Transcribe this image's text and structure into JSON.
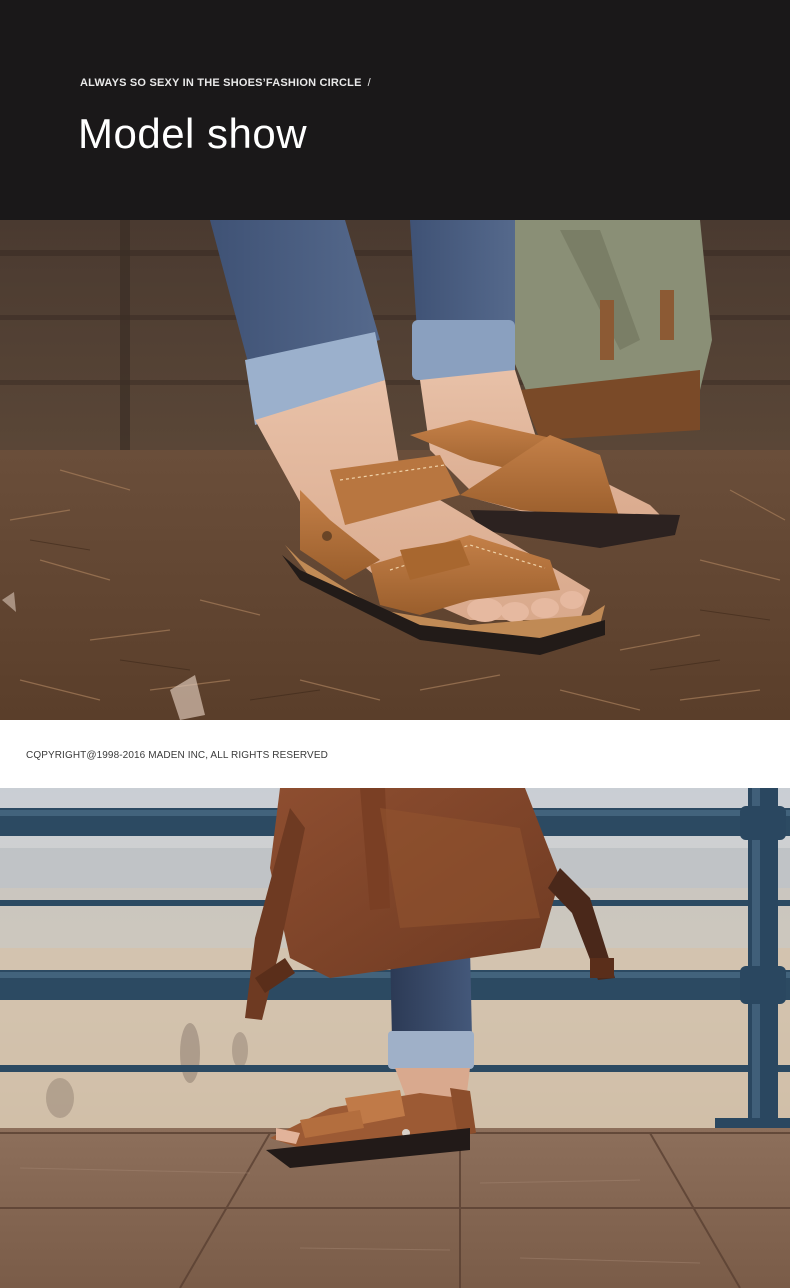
{
  "header": {
    "tagline": "ALWAYS SO SEXY IN THE SHOES’FASHION CIRCLE",
    "tagline_separator": "/",
    "title": "Model show"
  },
  "footer": {
    "copyright": "CQPYRIGHT@1998-2016 MADEN INC, ALL RIGHTS RESERVED"
  },
  "colors": {
    "header_bg": "#1a1819",
    "sandal_tan": "#b8743a",
    "denim": "#4a5d7e",
    "ground": "#6b4a30",
    "railing": "#2d4a60",
    "boardwalk": "#8a6a55"
  }
}
